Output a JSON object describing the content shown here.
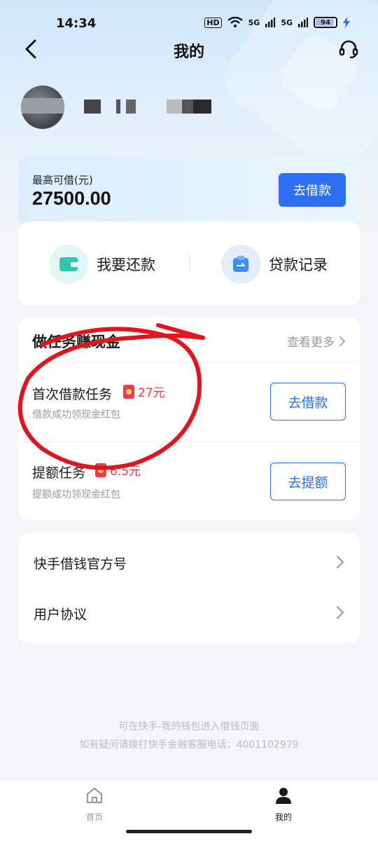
{
  "status_bar": {
    "time": "14:34",
    "hd_label": "HD",
    "signal1": "5G",
    "signal2": "5G",
    "battery": "94"
  },
  "header": {
    "title": "我的"
  },
  "limit": {
    "label": "最高可借(元)",
    "amount": "27500.00",
    "button": "去借款"
  },
  "actions": [
    {
      "label": "我要还款",
      "icon": "wallet-icon",
      "color": "#2fc7ae"
    },
    {
      "label": "贷款记录",
      "icon": "record-icon",
      "color": "#3d8df5"
    }
  ],
  "tasks": {
    "heading": "做任务赚现金",
    "see_more": "查看更多",
    "items": [
      {
        "title": "首次借款任务",
        "reward": "27元",
        "subtitle": "借款成功领现金红包",
        "button": "去借款"
      },
      {
        "title": "提额任务",
        "reward": "6.5元",
        "subtitle": "提额成功领现金红包",
        "button": "去提额"
      }
    ]
  },
  "menu": [
    {
      "label": "快手借钱官方号"
    },
    {
      "label": "用户协议"
    }
  ],
  "notes": {
    "line1": "可在快手-我的钱包进入借钱页面",
    "line2": "如有疑问请拨打快手金融客服电话：4001102979"
  },
  "bottom_nav": [
    {
      "label": "首页",
      "icon": "home-icon"
    },
    {
      "label": "我的",
      "icon": "profile-icon"
    }
  ],
  "colors": {
    "primary": "#2d6ff2",
    "reward": "#f23a4b",
    "annotation": "#e0161e"
  }
}
